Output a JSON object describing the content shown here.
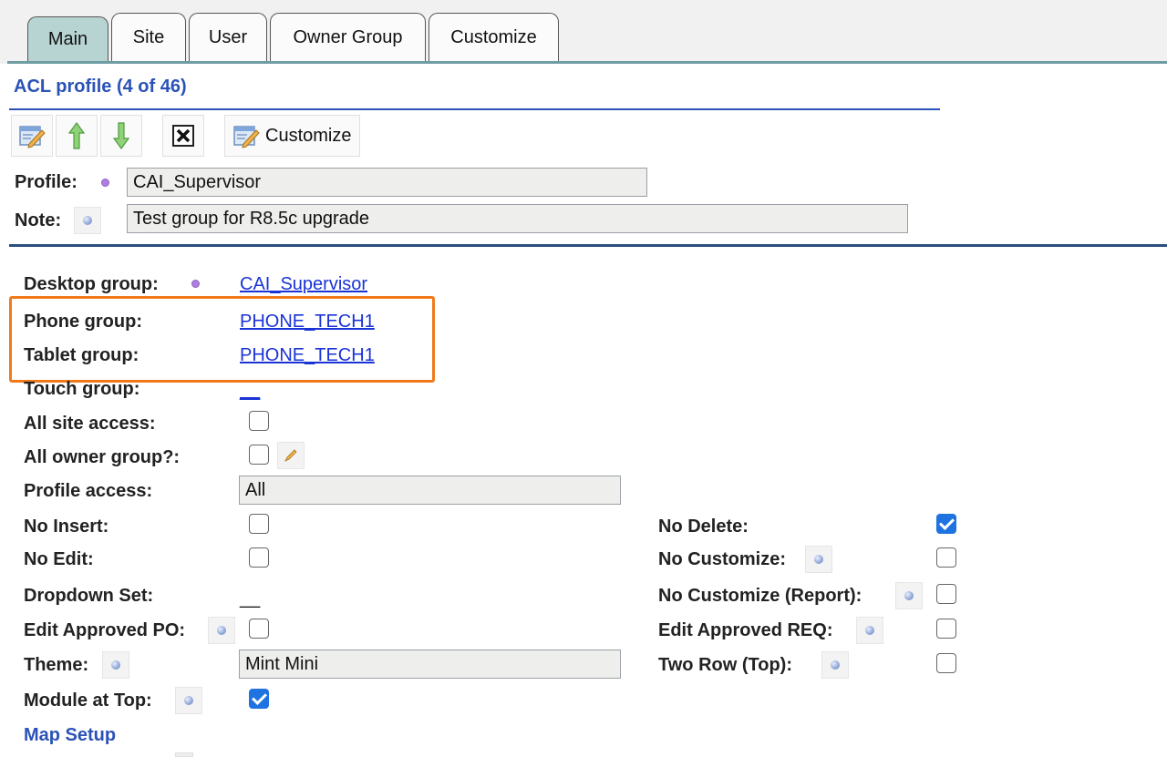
{
  "tabs": [
    {
      "label": "Main",
      "active": true
    },
    {
      "label": "Site",
      "active": false
    },
    {
      "label": "User",
      "active": false
    },
    {
      "label": "Owner Group",
      "active": false
    },
    {
      "label": "Customize",
      "active": false
    }
  ],
  "header": {
    "title": "ACL profile (4 of 46)"
  },
  "toolbar": {
    "edit_icon": "edit-icon",
    "up_icon": "arrow-up-icon",
    "down_icon": "arrow-down-icon",
    "delete_icon": "delete-icon",
    "customize_label": "Customize"
  },
  "profile": {
    "label": "Profile:",
    "value": "CAI_Supervisor"
  },
  "note": {
    "label": "Note:",
    "value": "Test group for R8.5c upgrade"
  },
  "groups": {
    "desktop_label": "Desktop group:",
    "desktop_value": "CAI_Supervisor",
    "phone_label": "Phone group:",
    "phone_value": "PHONE_TECH1",
    "tablet_label": "Tablet group:",
    "tablet_value": "PHONE_TECH1",
    "touch_label": "Touch group:",
    "touch_value": "__"
  },
  "fields": {
    "all_site_access_label": "All site access:",
    "all_site_access_checked": false,
    "all_owner_group_label": "All owner group?:",
    "all_owner_group_checked": false,
    "profile_access_label": "Profile access:",
    "profile_access_value": "All",
    "no_insert_label": "No Insert:",
    "no_insert_checked": false,
    "no_edit_label": "No Edit:",
    "no_edit_checked": false,
    "dropdown_set_label": "Dropdown Set:",
    "dropdown_set_value": "__",
    "edit_approved_po_label": "Edit Approved PO:",
    "edit_approved_po_checked": false,
    "theme_label": "Theme:",
    "theme_value": "Mint Mini",
    "module_at_top_label": "Module at Top:",
    "module_at_top_checked": true,
    "no_delete_label": "No Delete:",
    "no_delete_checked": true,
    "no_customize_label": "No Customize:",
    "no_customize_checked": false,
    "no_customize_report_label": "No Customize (Report):",
    "no_customize_report_checked": false,
    "edit_approved_req_label": "Edit Approved REQ:",
    "edit_approved_req_checked": false,
    "two_row_top_label": "Two Row (Top):",
    "two_row_top_checked": false
  },
  "map_setup": {
    "label": "Map Setup"
  },
  "colors": {
    "tab_active": "#b7d4d3",
    "heading_blue": "#2a52b7",
    "link_blue": "#1a33d6",
    "highlight_orange": "#f07a1a",
    "checkbox_checked": "#1f73e0"
  }
}
